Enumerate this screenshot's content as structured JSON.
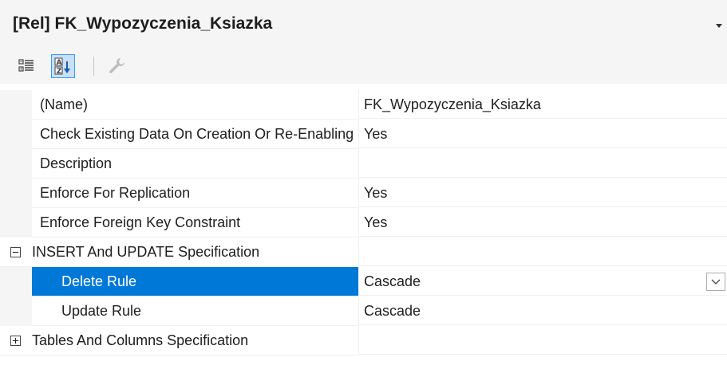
{
  "header": {
    "title": "[Rel] FK_Wypozyczenia_Ksiazka"
  },
  "toolbar": {
    "categorized": {
      "icon": "categorized-icon"
    },
    "alphabetical": {
      "icon": "alphabetical-sort-icon",
      "active": true
    },
    "property_pages": {
      "icon": "wrench-icon",
      "enabled": false
    }
  },
  "properties": [
    {
      "name": "(Name)",
      "value": "FK_Wypozyczenia_Ksiazka"
    },
    {
      "name": "Check Existing Data On Creation Or Re-Enabling",
      "value": "Yes"
    },
    {
      "name": "Description",
      "value": ""
    },
    {
      "name": "Enforce For Replication",
      "value": "Yes"
    },
    {
      "name": "Enforce Foreign Key Constraint",
      "value": "Yes"
    },
    {
      "name": "INSERT And UPDATE Specification",
      "value": "",
      "expandable": true,
      "expanded": true,
      "children": [
        {
          "name": "Delete Rule",
          "value": "Cascade",
          "selected": true
        },
        {
          "name": "Update Rule",
          "value": "Cascade"
        }
      ]
    },
    {
      "name": "Tables And Columns Specification",
      "value": "",
      "expandable": true,
      "expanded": false
    }
  ],
  "colors": {
    "selection": "#0078d7",
    "toolbar_active": "#c9e0f7",
    "panel_bg": "#f5f5f5"
  }
}
